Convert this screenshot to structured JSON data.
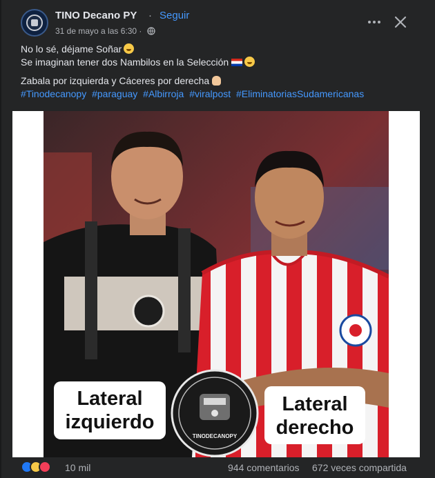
{
  "post": {
    "page_name": "TINO Decano PY",
    "separator": "·",
    "follow_label": "Seguir",
    "date": "31 de mayo a las 6:30",
    "separator_meta": "·",
    "privacy_icon": "globe-icon",
    "more_icon": "more-options-icon",
    "close_icon": "close-icon"
  },
  "caption": {
    "line1": "No lo sé, déjame Soñar",
    "line2": "Se imaginan tener dos Nambilos en la Selección",
    "line3": "Zabala por izquierda y Cáceres por derecha",
    "hashtags": [
      "#Tinodecanopy",
      "#paraguay",
      "#Albirroja",
      "#viralpost",
      "#EliminatoriasSudamericanas"
    ]
  },
  "image": {
    "label_left": [
      "Lateral",
      "izquierdo"
    ],
    "label_right": [
      "Lateral",
      "derecho"
    ],
    "badge_text": "TINODECANOPY"
  },
  "stats": {
    "reaction_icons": [
      "like-icon",
      "haha-icon",
      "love-icon"
    ],
    "reaction_count": "10 mil",
    "comments": "944 comentarios",
    "shares": "672 veces compartida"
  },
  "colors": {
    "background": "#242526",
    "link": "#4599ff",
    "text": "#e4e6eb",
    "muted": "#b0b3b8"
  }
}
